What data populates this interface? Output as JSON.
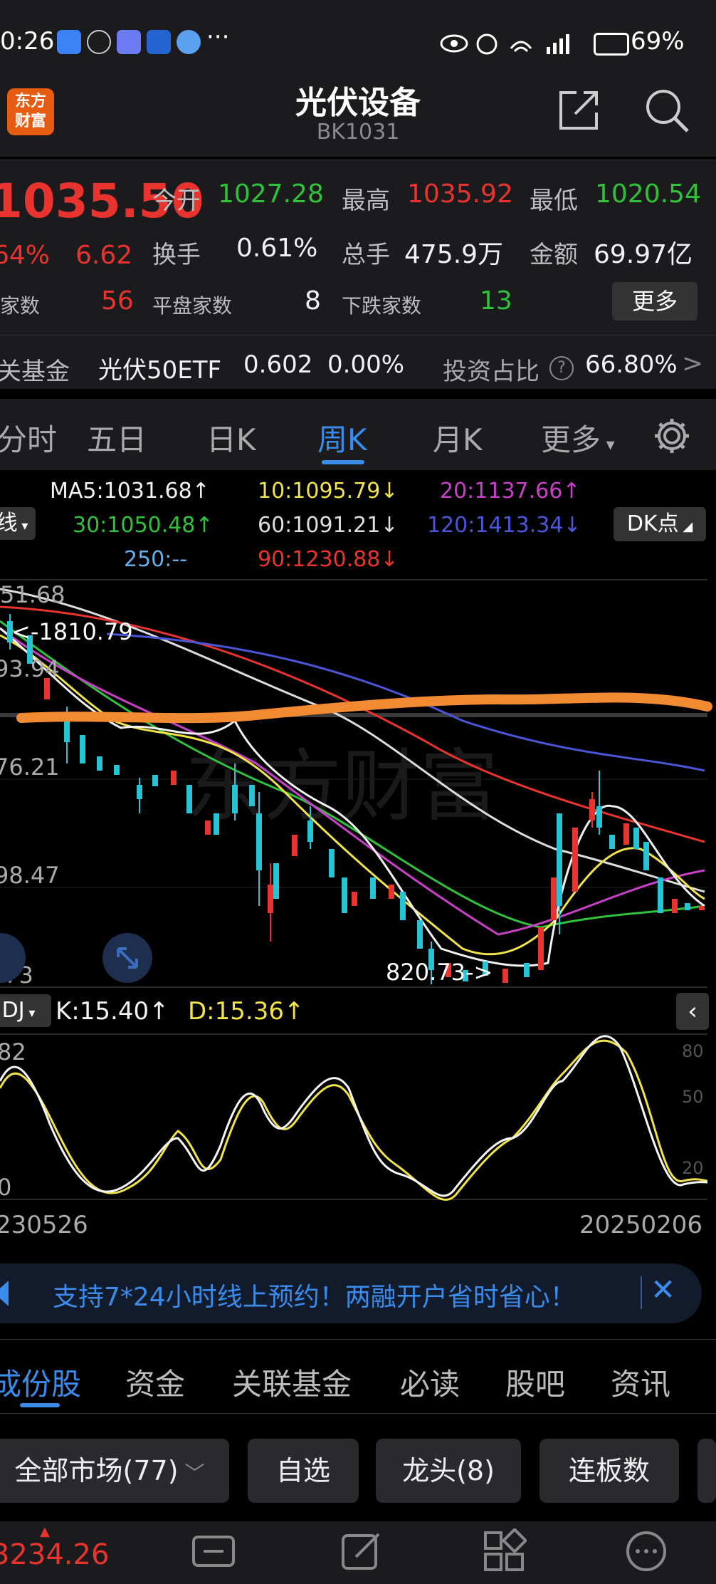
{
  "status_bar": {
    "time": "0:26",
    "battery": "69%"
  },
  "header": {
    "logo_text": "东方\n财富",
    "title": "光伏设备",
    "code": "BK1031"
  },
  "quote": {
    "price": "1035.50",
    "change_pct": "64%",
    "change": "6.62",
    "open_label": "今开",
    "open": "1027.28",
    "high_label": "最高",
    "high": "1035.92",
    "low_label": "最低",
    "low": "1020.54",
    "turnover_label": "换手",
    "turnover": "0.61%",
    "volume_label": "总手",
    "volume": "475.9万",
    "amount_label": "金额",
    "amount": "69.97亿",
    "up_label": "涨家数",
    "up_count": "56",
    "flat_label": "平盘家数",
    "flat_count": "8",
    "down_label": "下跌家数",
    "down_count": "13",
    "more_label": "更多",
    "fund_label": "关基金",
    "fund_name": "光伏50ETF",
    "fund_price": "0.602",
    "fund_change": "0.00%",
    "invest_ratio_label": "投资占比",
    "invest_ratio": "66.80%"
  },
  "period_tabs": [
    "分时",
    "五日",
    "日K",
    "周K",
    "月K",
    "更多"
  ],
  "active_tab": "周K",
  "ma": {
    "ma5": "MA5:1031.68↑",
    "ma10": "10:1095.79↓",
    "ma20": "20:1137.66↑",
    "ma30": "30:1050.48↑",
    "ma60": "60:1091.21↓",
    "ma120": "120:1413.34↓",
    "ma250": "250:--",
    "ma90": "90:1230.88↓",
    "left_chip": "线",
    "dk_chip": "DK点"
  },
  "chart": {
    "price_labels": [
      "51.68",
      "93.94",
      "76.21",
      "98.47",
      ".73"
    ],
    "high_marker": "<-1810.79",
    "low_marker": "820.73->",
    "kdj_title": "DJ",
    "k_value": "K:15.40↑",
    "d_value": "D:15.36↑",
    "kdj_top": "82",
    "kdj_bottom": "0",
    "kdj_scale": [
      "80",
      "50",
      "20"
    ],
    "date_start": "230526",
    "date_end": "20250206",
    "watermark": "东方财富"
  },
  "colors": {
    "red": "#e8332f",
    "green": "#2fc23a",
    "accent": "#3a8bea",
    "orange": "#f28a32",
    "yellow": "#f1e34a"
  },
  "banner": {
    "text": "支持7*24小时线上预约！两融开户省时省心！"
  },
  "bottom_tabs": [
    "成份股",
    "资金",
    "关联基金",
    "必读",
    "股吧",
    "资讯"
  ],
  "filters": {
    "market": "全部市场(77)",
    "self": "自选",
    "leader": "龙头(8)",
    "board": "连板数"
  },
  "index_ticker": {
    "value": "3234.26"
  }
}
